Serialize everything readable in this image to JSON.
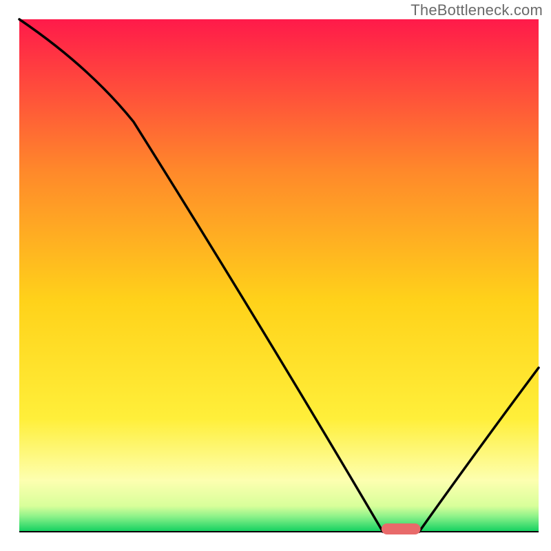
{
  "attribution": "TheBottleneck.com",
  "colors": {
    "gradient_top": "#ff1a4a",
    "gradient_mid1": "#ff9a1f",
    "gradient_mid2": "#ffe21a",
    "gradient_low": "#ffffa0",
    "gradient_bottom": "#10d060",
    "axis": "#000000",
    "curve": "#000000",
    "marker": "#e86a6a"
  },
  "chart_data": {
    "type": "line",
    "title": "",
    "xlabel": "",
    "ylabel": "",
    "xlim": [
      0,
      100
    ],
    "ylim": [
      0,
      100
    ],
    "grid": false,
    "x": [
      0,
      22,
      70,
      77,
      100
    ],
    "values": [
      100,
      80,
      0,
      0,
      32
    ],
    "marker": {
      "x_start": 70,
      "x_end": 77,
      "y": 0
    },
    "notes": "Gradient background from red (top) through orange, yellow, pale yellow to green (bottom). Black curve descends from top-left, kinks around x≈22, reaches y=0 near x≈70–77, then rises toward the right edge. A short rounded salmon marker sits on the baseline at the trough."
  }
}
